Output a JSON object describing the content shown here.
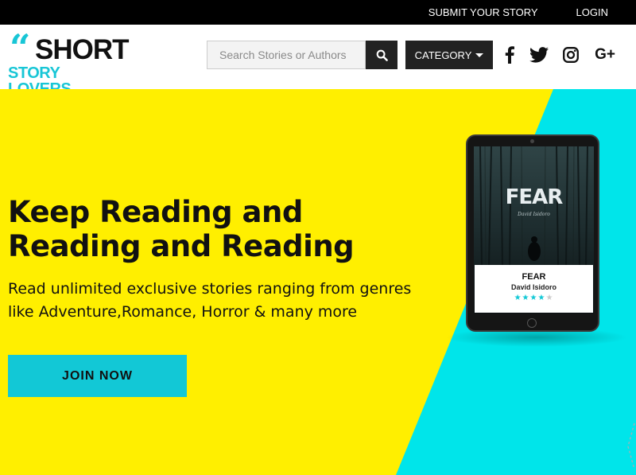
{
  "topbar": {
    "submit_label": "SUBMIT YOUR STORY",
    "login_label": "LOGIN"
  },
  "logo": {
    "quote_glyph": "“",
    "line1": "SHORT",
    "line2": "STORY LOVERS"
  },
  "search": {
    "placeholder": "Search Stories or Authors",
    "icon": "search-icon"
  },
  "category": {
    "label": "CATEGORY",
    "icon": "caret-down-icon"
  },
  "social": [
    "facebook-icon",
    "twitter-icon",
    "instagram-icon",
    "google-plus-icon"
  ],
  "social_gplus_text": "G+",
  "hero": {
    "headline": "Keep Reading and Reading and Reading",
    "subline": "Read unlimited exclusive stories ranging from genres like Adventure,Romance, Horror & many more",
    "join_label": "JOIN NOW"
  },
  "book": {
    "cover_title": "FEAR",
    "cover_author": "David Isidoro",
    "card_title": "FEAR",
    "card_author": "David Isidoro",
    "rating": 4,
    "rating_max": 5
  },
  "colors": {
    "accent_cyan": "#12c8d6",
    "hero_yellow": "#ffef00",
    "hero_cyan": "#00e5ea",
    "dark": "#222222"
  }
}
